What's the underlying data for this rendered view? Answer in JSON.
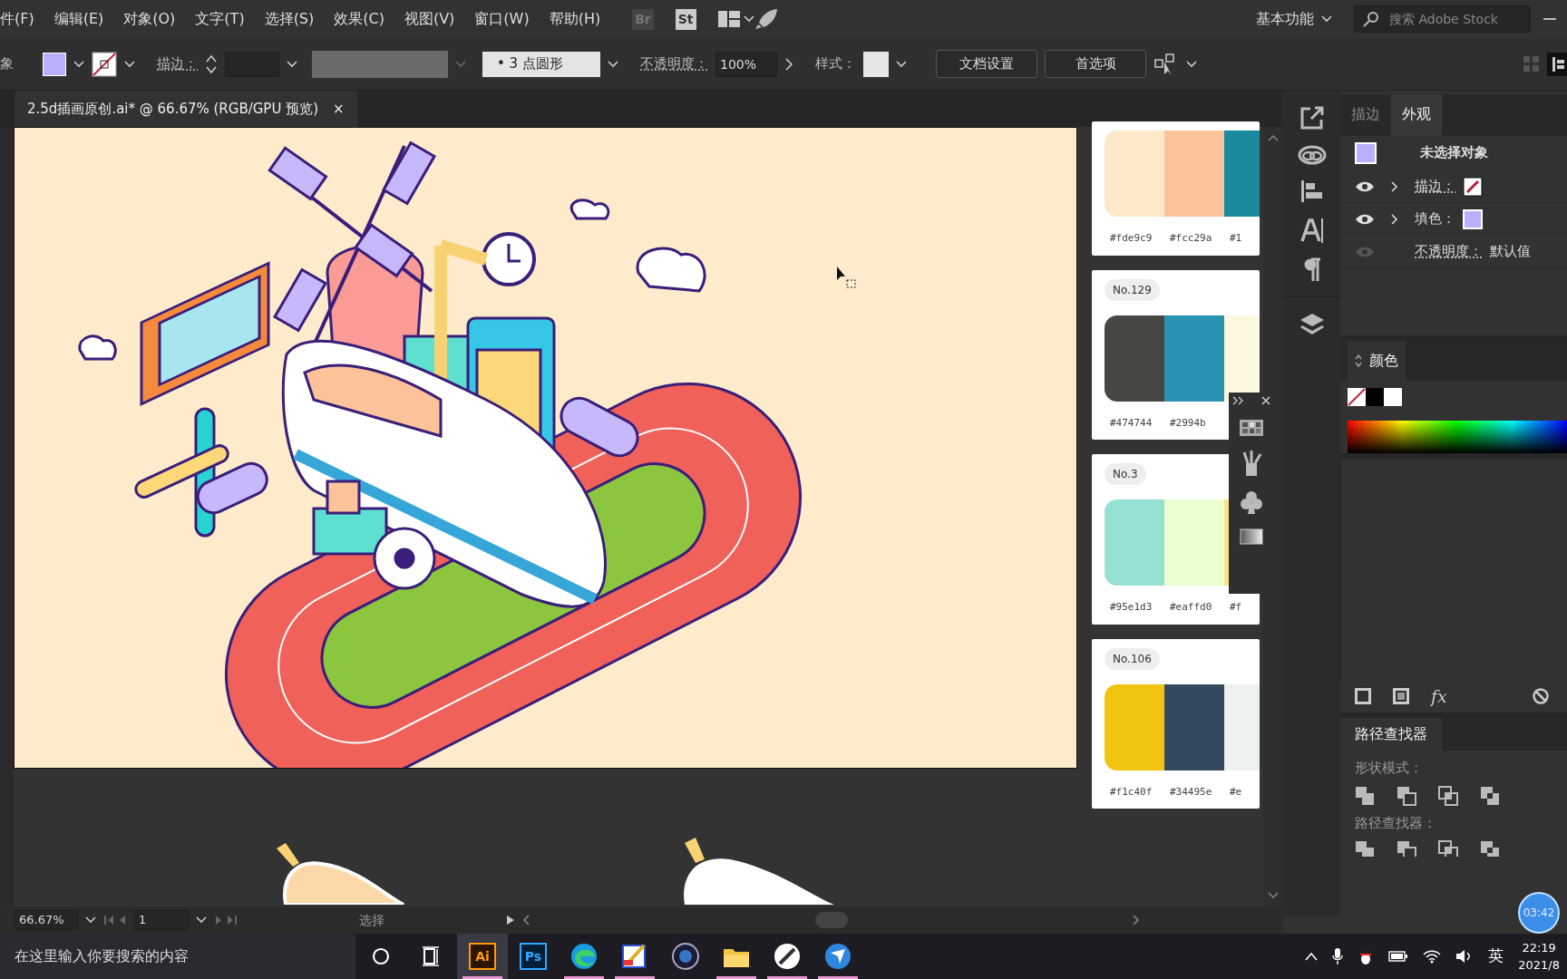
{
  "menu_bar": {
    "items": [
      "件(F)",
      "编辑(E)",
      "对象(O)",
      "文字(T)",
      "选择(S)",
      "效果(C)",
      "视图(V)",
      "窗口(W)",
      "帮助(H)"
    ],
    "app_buttons": [
      "Br",
      "St"
    ],
    "workspace": "基本功能",
    "search": {
      "placeholder": "搜索 Adobe Stock"
    }
  },
  "control_bar": {
    "selection_label": "象",
    "fill_swatch": {
      "color": "#b9b0fb"
    },
    "stroke_label": "描边：",
    "brush_dot": "•",
    "brush": "3 点圆形",
    "opacity_label": "不透明度：",
    "opacity": "100%",
    "style_label": "样式：",
    "buttons": [
      "文档设置",
      "首选项"
    ]
  },
  "document_tab": {
    "title": "2.5d插画原创.ai* @ 66.67% (RGB/GPU 预览)",
    "close": "×",
    "selected": true
  },
  "swatch_cards": [
    {
      "swatches": [
        {
          "color": "#fde9c9",
          "hex": "#fde9c9"
        },
        {
          "color": "#fcc29a",
          "hex": "#fcc29a"
        },
        {
          "color": "#1a8a9c",
          "hex": "#1"
        }
      ]
    },
    {
      "number": "No.129",
      "swatches": [
        {
          "color": "#474744",
          "hex": "#474744"
        },
        {
          "color": "#2994b1",
          "hex": "#2994b"
        },
        {
          "color": "#fcf8e0"
        }
      ]
    },
    {
      "number": "No.3",
      "swatches": [
        {
          "color": "#95e1d3",
          "hex": "#95e1d3"
        },
        {
          "color": "#eaffd0",
          "hex": "#eaffd0"
        },
        {
          "color": "#fce38a",
          "hex": "#f"
        }
      ]
    },
    {
      "number": "No.106",
      "swatches": [
        {
          "color": "#f1c40f",
          "hex": "#f1c40f"
        },
        {
          "color": "#34495e",
          "hex": "#34495e"
        },
        {
          "color": "#ecf0f1",
          "hex": "#e"
        }
      ]
    }
  ],
  "panel_tabs": [
    {
      "label": "描边",
      "selected": false
    },
    {
      "label": "外观",
      "selected": true
    }
  ],
  "appearance": {
    "title": "未选择对象",
    "rows": [
      {
        "kind": "stroke",
        "label": "描边：",
        "visible": true
      },
      {
        "kind": "fill",
        "label": "填色：",
        "visible": true
      },
      {
        "kind": "opacity",
        "label": "不透明度：",
        "value": "默认值",
        "visible": false
      }
    ]
  },
  "color_panel": {
    "title": "颜色"
  },
  "appearance_footer": {
    "effects_button": "fx"
  },
  "pathfinder": {
    "title": "路径查找器",
    "shape_modes_label": "形状模式：",
    "pathfinders_label": "路径查找器："
  },
  "status_bar": {
    "zoom": "66.67%",
    "page": "1",
    "tool": "选择"
  },
  "recording_badge": "03:42",
  "taskbar": {
    "search_placeholder": "在这里输入你要搜索的内容",
    "apps": [
      {
        "kind": "ai",
        "label": "Ai",
        "selected": true,
        "running": true
      },
      {
        "kind": "ps",
        "label": "Ps",
        "selected": false,
        "running": false
      },
      {
        "kind": "edge",
        "selected": false,
        "running": true
      },
      {
        "kind": "paint",
        "selected": false,
        "running": true
      },
      {
        "kind": "c4d",
        "selected": false,
        "running": false
      },
      {
        "kind": "folder",
        "selected": false,
        "running": true
      },
      {
        "kind": "pen",
        "selected": false,
        "running": true
      },
      {
        "kind": "bird",
        "selected": false,
        "running": true
      }
    ],
    "ime": "英",
    "time": "22:19",
    "date": "2021/8"
  }
}
